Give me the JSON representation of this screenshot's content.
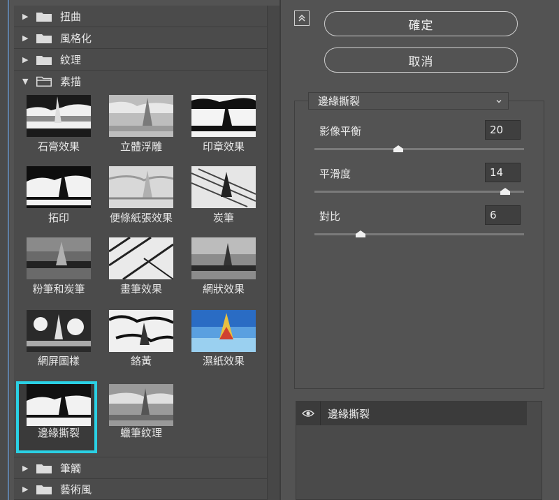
{
  "dialog": {
    "ok_label": "確定",
    "cancel_label": "取消"
  },
  "folders_top": [
    {
      "label": "扭曲",
      "expanded": false
    },
    {
      "label": "風格化",
      "expanded": false
    },
    {
      "label": "紋理",
      "expanded": false
    },
    {
      "label": "素描",
      "expanded": true
    }
  ],
  "folders_bottom": [
    {
      "label": "筆觸",
      "expanded": false
    },
    {
      "label": "藝術風",
      "expanded": false
    }
  ],
  "filters": [
    {
      "label": "石膏效果"
    },
    {
      "label": "立體浮雕"
    },
    {
      "label": "印章效果"
    },
    {
      "label": "拓印"
    },
    {
      "label": "便條紙張效果"
    },
    {
      "label": "炭筆"
    },
    {
      "label": "粉筆和炭筆"
    },
    {
      "label": "畫筆效果"
    },
    {
      "label": "網狀效果"
    },
    {
      "label": "網屏圖樣"
    },
    {
      "label": "鉻黃"
    },
    {
      "label": "濕紙效果"
    },
    {
      "label": "邊緣撕裂",
      "selected": true
    },
    {
      "label": "蠟筆紋理"
    }
  ],
  "settings": {
    "filter_select": "邊緣撕裂",
    "params": [
      {
        "label": "影像平衡",
        "value": "20",
        "fraction": 0.4
      },
      {
        "label": "平滑度",
        "value": "14",
        "fraction": 0.91
      },
      {
        "label": "對比",
        "value": "6",
        "fraction": 0.22
      }
    ]
  },
  "layers": [
    {
      "name": "邊緣撕裂",
      "visible": true
    }
  ],
  "colors": {
    "selection": "#2ad0e4",
    "panel": "#535353",
    "gallery": "#4b4b4b"
  }
}
